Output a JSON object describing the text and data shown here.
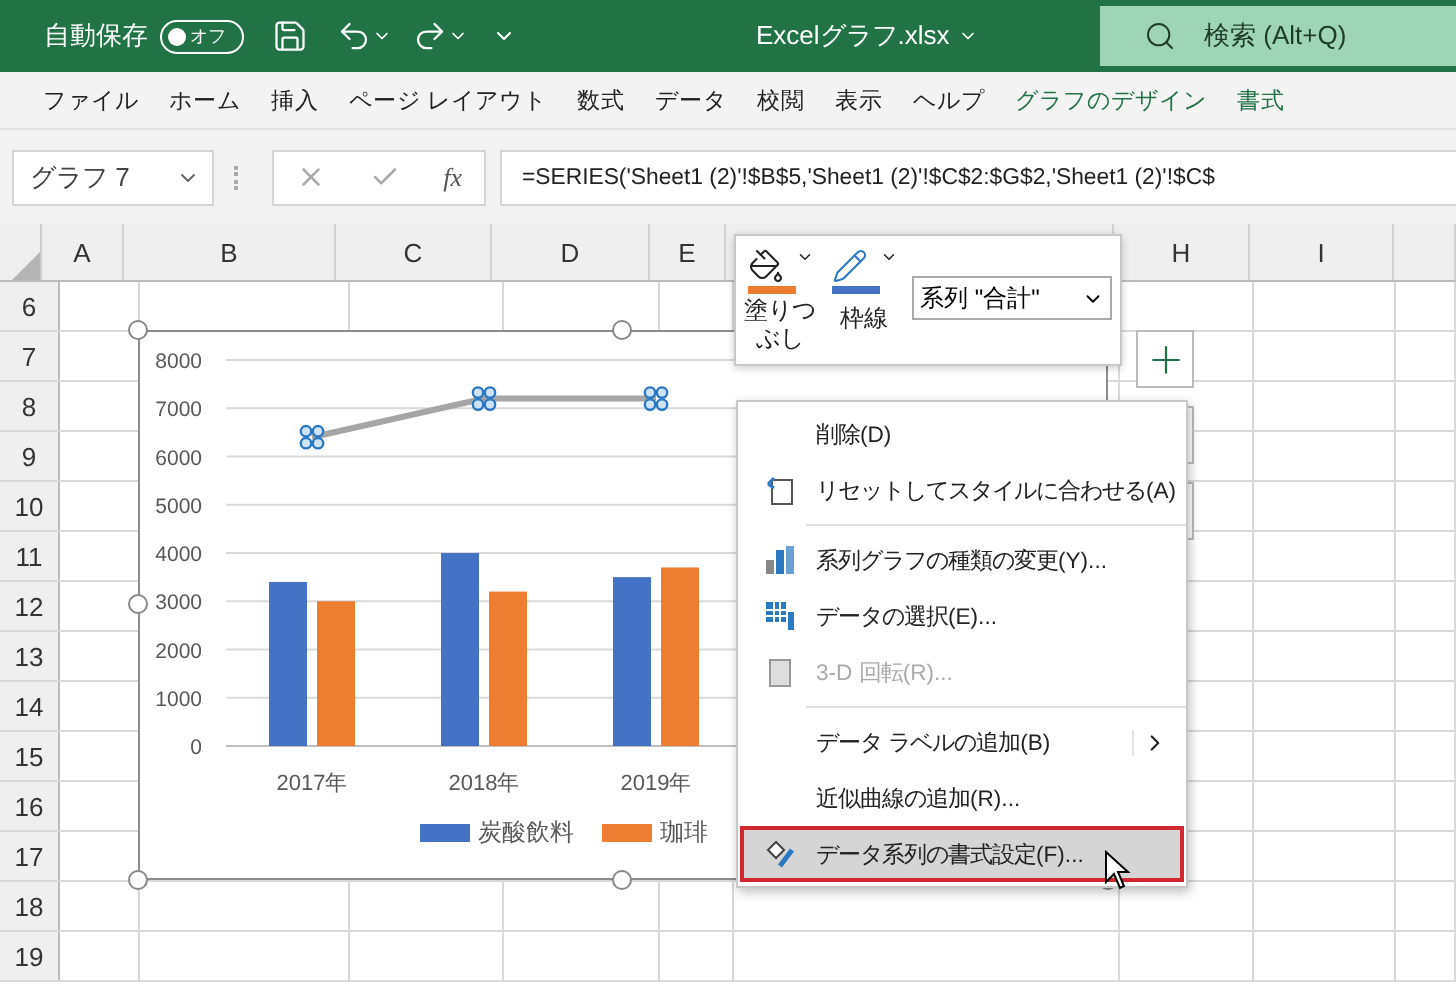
{
  "title_bar": {
    "autosave_label": "自動保存",
    "autosave": {
      "label": "オフ",
      "on": false
    },
    "file_name": "Excelグラフ.xlsx",
    "search": {
      "placeholder": "検索 (Alt+Q)"
    }
  },
  "ribbon_tabs": [
    {
      "label": "ファイル",
      "contextual": false
    },
    {
      "label": "ホーム",
      "contextual": false
    },
    {
      "label": "挿入",
      "contextual": false
    },
    {
      "label": "ページ レイアウト",
      "contextual": false
    },
    {
      "label": "数式",
      "contextual": false
    },
    {
      "label": "データ",
      "contextual": false
    },
    {
      "label": "校閲",
      "contextual": false
    },
    {
      "label": "表示",
      "contextual": false
    },
    {
      "label": "ヘルプ",
      "contextual": false
    },
    {
      "label": "グラフのデザイン",
      "contextual": true
    },
    {
      "label": "書式",
      "contextual": true
    }
  ],
  "formula_bar": {
    "name_box": "グラフ 7",
    "fx_label": "fx",
    "formula": "=SERIES('Sheet1 (2)'!$B$5,'Sheet1 (2)'!$C$2:$G$2,'Sheet1 (2)'!$C$"
  },
  "sheet": {
    "columns": [
      "A",
      "B",
      "C",
      "D",
      "E",
      "H",
      "I"
    ],
    "rows": [
      "6",
      "7",
      "8",
      "9",
      "10",
      "11",
      "12",
      "13",
      "14",
      "15",
      "16",
      "17",
      "18",
      "19"
    ]
  },
  "chart": {
    "chart_data": {
      "type": "bar",
      "categories": [
        "2017年",
        "2018年",
        "2019年"
      ],
      "ylim": [
        0,
        8000
      ],
      "grid": true,
      "yticks": [
        0,
        1000,
        2000,
        3000,
        4000,
        5000,
        6000,
        7000,
        8000
      ],
      "series": [
        {
          "name": "炭酸飲料",
          "color": "#4472c4",
          "type": "bar",
          "values": [
            3400,
            4000,
            3500
          ]
        },
        {
          "name": "珈琲",
          "color": "#ed7d31",
          "type": "bar",
          "values": [
            3000,
            3200,
            3700
          ]
        },
        {
          "color": "#a5a5a5",
          "type": "line",
          "values": [
            6400,
            7200,
            7200
          ]
        }
      ]
    }
  },
  "mini_toolbar": {
    "fill_label": "塗りつぶし",
    "outline_label": "枠線",
    "series_select": "系列 \"合計\""
  },
  "context_menu": [
    {
      "kind": "item",
      "label": "削除(D)",
      "disabled": false,
      "selected": false,
      "submenu": false
    },
    {
      "kind": "item",
      "label": "リセットしてスタイルに合わせる(A)",
      "disabled": false,
      "selected": false,
      "submenu": false
    },
    {
      "kind": "separator"
    },
    {
      "kind": "item",
      "label": "系列グラフの種類の変更(Y)...",
      "disabled": false,
      "selected": false,
      "submenu": false
    },
    {
      "kind": "item",
      "label": "データの選択(E)...",
      "disabled": false,
      "selected": false,
      "submenu": false
    },
    {
      "kind": "item",
      "label": "3-D 回転(R)...",
      "disabled": true,
      "selected": false,
      "submenu": false
    },
    {
      "kind": "separator"
    },
    {
      "kind": "item",
      "label": "データ ラベルの追加(B)",
      "disabled": false,
      "selected": false,
      "submenu": true
    },
    {
      "kind": "item",
      "label": "近似曲線の追加(R)...",
      "disabled": false,
      "selected": false,
      "submenu": false
    },
    {
      "kind": "item",
      "label": "データ系列の書式設定(F)...",
      "disabled": false,
      "selected": true,
      "submenu": false
    }
  ]
}
